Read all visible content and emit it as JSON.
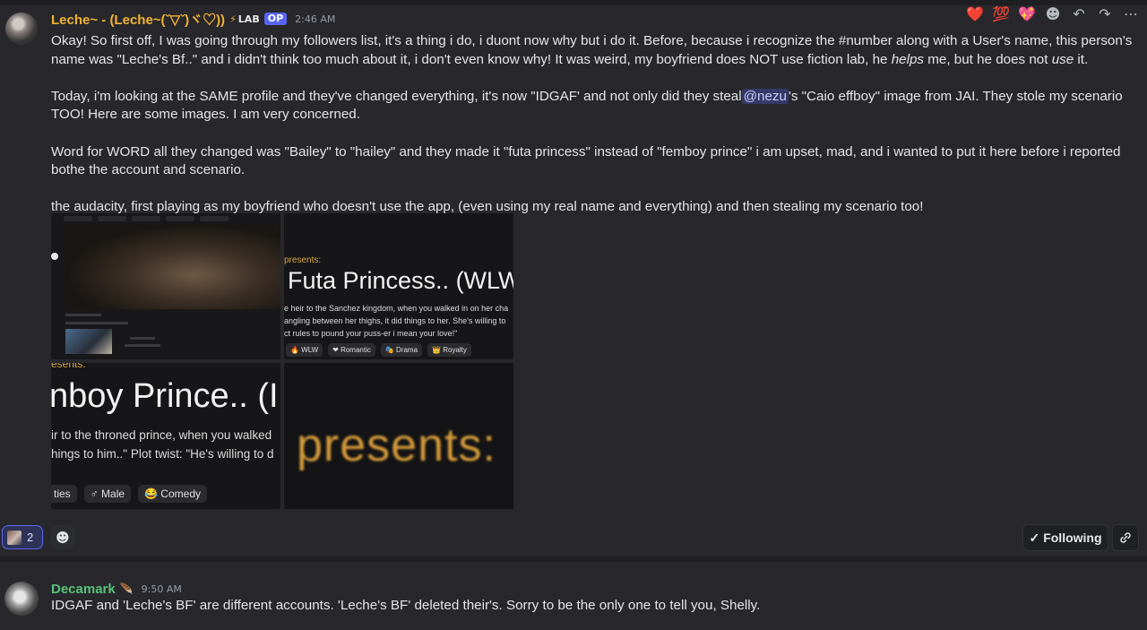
{
  "colors": {
    "username1": "#f0b232",
    "username2": "#57c27a",
    "accent": "#5865f2",
    "presents": "#d9a441"
  },
  "top_reactions": [
    {
      "icon": "heart-icon",
      "glyph": "❤️"
    },
    {
      "icon": "hundred-icon",
      "glyph": "💯"
    },
    {
      "icon": "sparkle-heart-icon",
      "glyph": "💖"
    }
  ],
  "message_actions": [
    {
      "icon": "add-reaction-icon",
      "glyph": "☻"
    },
    {
      "icon": "reply-icon",
      "glyph": "↶"
    },
    {
      "icon": "forward-icon",
      "glyph": "↷"
    },
    {
      "icon": "more-icon",
      "glyph": "⋯"
    }
  ],
  "message1": {
    "username": "Leche~ - (Leche~(ˇ▽ˇ)ヾ♡))",
    "lab_tag": "LAB",
    "op_tag": "OP",
    "timestamp": "2:46 AM",
    "p1": "Okay! So first off, I was going through my followers list, it's a thing i do, i duont now why but i do it. Before, because i recognize the #number along with a User's name, this person's name was \"Leche's Bf..\" and i didn't think too much about it, i don't even know why! It was weird, my boyfriend does NOT use fiction lab, he ",
    "p1_em1": "helps",
    "p1_mid": " me, but he does not ",
    "p1_em2": "use",
    "p1_end": " it.",
    "p2_start": "Today, i'm looking at the SAME profile and they've changed everything, it's now \"IDGAF' and not only did they steal",
    "p2_mention": "@nezu",
    "p2_end": "'s \"Caio effboy\" image from JAI. They stole my scenario TOO! Here are some images. I am very concerned.",
    "p3": "Word for WORD all they changed was \"Bailey\" to \"hailey\" and they made it \"futa princess\" instead of \"femboy prince\" i am upset, mad, and i wanted to put it here before i reported bothe the account and scenario.",
    "p4": "the audacity, first playing as my boyfriend who doesn't use the app, (even using my real name and everything) and then stealing my scenario too!"
  },
  "gallery": {
    "tile2": {
      "presents": "presents:",
      "title": "Futa Princess.. (WLW",
      "desc": [
        "e heir to the Sanchez kingdom, when you walked in on her cha",
        "angling between her thighs, it did things to her. She's willing to",
        "ct rules to pound your puss-er i mean your love!\""
      ],
      "chips": [
        "🔥 WLW",
        "❤ Romantic",
        "🎭 Drama",
        "👑 Royalty"
      ]
    },
    "tile3": {
      "presents": "esents:",
      "title": "nboy Prince.. (I",
      "desc": [
        "ir to the throned prince, when you walked",
        "hings to him..\" Plot twist: \"He's willing to d"
      ],
      "chips": [
        "ties",
        "♂ Male",
        "😂 Comedy"
      ]
    },
    "tile4": {
      "presents": "presents:"
    }
  },
  "reaction_bar": {
    "count": "2",
    "follow_label": "Following",
    "follow_icon": "✓",
    "link_icon": "🔗",
    "add_reaction_glyph": "☻"
  },
  "message2": {
    "username": "Decamark",
    "badge": "🪶",
    "timestamp": "9:50 AM",
    "text": "IDGAF and 'Leche's BF' are different accounts. 'Leche's BF' deleted their's. Sorry to be the only one to tell you, Shelly."
  }
}
